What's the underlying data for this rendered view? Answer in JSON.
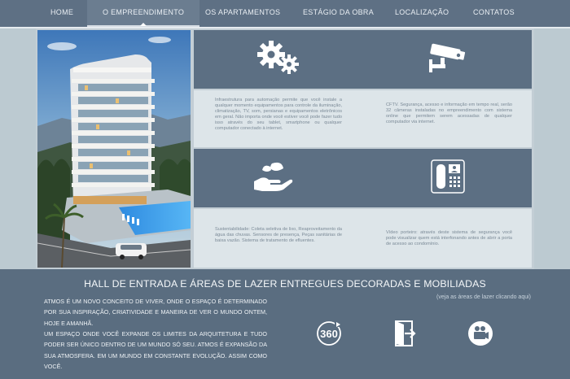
{
  "nav": {
    "items": [
      {
        "label": "HOME"
      },
      {
        "label": "O EMPREENDIMENTO"
      },
      {
        "label": "OS APARTAMENTOS"
      },
      {
        "label": "ESTÁGIO DA OBRA"
      },
      {
        "label": "LOCALIZAÇÃO"
      },
      {
        "label": "CONTATOS"
      }
    ],
    "active_index": 1
  },
  "features": {
    "automation": {
      "icon": "gears-icon",
      "text": "Infraestrutura para automação permite que você instale a qualquer momento equipamentos para controle da iluminação, climatização, TV, som, persianas e equipamentos eletrônicos em geral. Não importa onde você estiver você pode fazer tudo isso através do seu tablet, smartphone ou qualquer computador conectado à internet."
    },
    "cftv": {
      "icon": "security-camera-icon",
      "text": "CFTV. Segurança, acesso e informação em tempo real, serão 32 câmeras instaladas no empreendimento com sistema online que permitem serem acessadas de qualquer computador via internet."
    },
    "sustainability": {
      "icon": "hand-leaf-icon",
      "text": "Sustentabilidade: Coleta seletiva de lixo, Reaproveitamento da água das chuvas. Sensores de presença, Peças sanitárias de baixa vazão. Sistema de tratamento de efluentes."
    },
    "videophone": {
      "icon": "video-intercom-icon",
      "text": "Vídeo porteiro: através deste sistema de segurança você pode visualizar quem está interfonando antes de abrir a porta de acesso ao condomínio."
    }
  },
  "bottom": {
    "title": "HALL DE ENTRADA E ÁREAS DE LAZER ENTREGUES DECORADAS E MOBILIADAS",
    "link": "(veja as áreas de lazer clicando aqui)",
    "paragraph_1": "ATMOS É UM NOVO CONCEITO DE VIVER, ONDE O ESPAÇO É DETERMINADO POR SUA INSPIRAÇÃO, CRIATIVIDADE E MANEIRA DE VER O MUNDO ONTEM, HOJE E AMANHÃ.",
    "paragraph_2": "UM ESPAÇO ONDE VOCÊ EXPANDE OS LIMITES DA ARQUITETURA E TUDO PODER SER ÚNICO DENTRO DE UM MUNDO SÓ SEU. ATMOS É EXPANSÃO DA SUA ATMOSFERA. EM UM MUNDO EM CONSTANTE EVOLUÇÃO. ASSIM COMO VOCÊ.",
    "icons": [
      "tour-360-icon",
      "exit-door-icon",
      "video-camera-icon"
    ]
  },
  "colors": {
    "nav_bg": "#5e7084",
    "dark_cell": "#5c6f83",
    "light_cell": "#dde5e9",
    "frame": "#c3ced5",
    "bottom_bg": "#5a6d80"
  }
}
